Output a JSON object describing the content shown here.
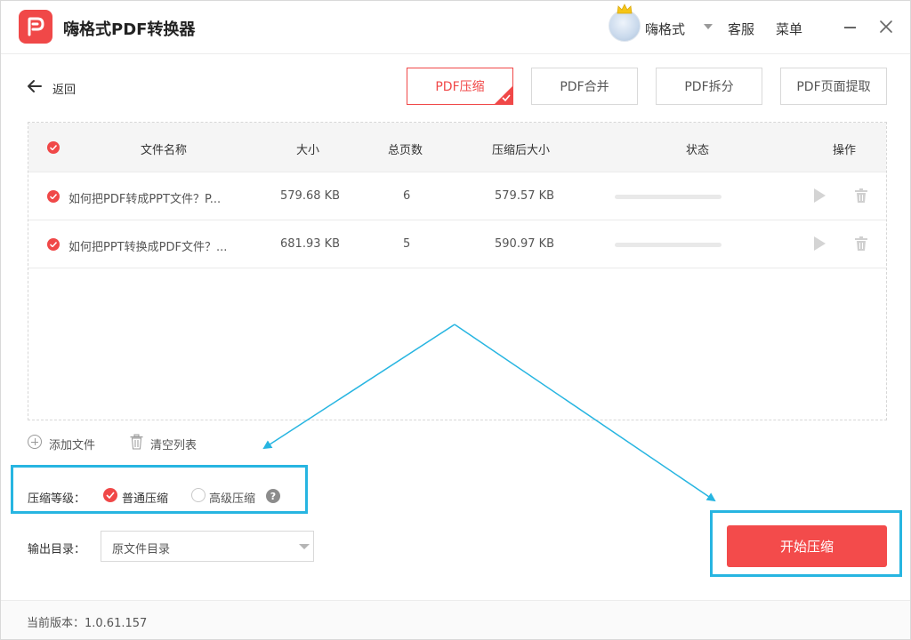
{
  "app": {
    "title": "嗨格式PDF转换器"
  },
  "header": {
    "username": "嗨格式",
    "service": "客服",
    "menu": "菜单"
  },
  "toolbar": {
    "back": "返回",
    "tabs": [
      {
        "label": "PDF压缩",
        "active": true
      },
      {
        "label": "PDF合并",
        "active": false
      },
      {
        "label": "PDF拆分",
        "active": false
      },
      {
        "label": "PDF页面提取",
        "active": false
      }
    ]
  },
  "table": {
    "columns": [
      "文件名称",
      "大小",
      "总页数",
      "压缩后大小",
      "状态",
      "操作"
    ],
    "rows": [
      {
        "name": "如何把PDF转成PPT文件？P...",
        "size": "579.68 KB",
        "pages": "6",
        "compressed": "579.57 KB",
        "progress": 0
      },
      {
        "name": "如何把PPT转换成PDF文件？...",
        "size": "681.93 KB",
        "pages": "5",
        "compressed": "590.97 KB",
        "progress": 0
      }
    ]
  },
  "actions": {
    "add": "添加文件",
    "clear": "清空列表"
  },
  "compression": {
    "label": "压缩等级：",
    "normal": "普通压缩",
    "advanced": "高级压缩",
    "selected": "普通压缩",
    "help": "?"
  },
  "output": {
    "label": "输出目录：",
    "value": "原文件目录"
  },
  "start": {
    "label": "开始压缩"
  },
  "footer": {
    "version": "当前版本：1.0.61.157"
  },
  "colors": {
    "accent": "#f04848",
    "highlight": "#27b5e1"
  }
}
